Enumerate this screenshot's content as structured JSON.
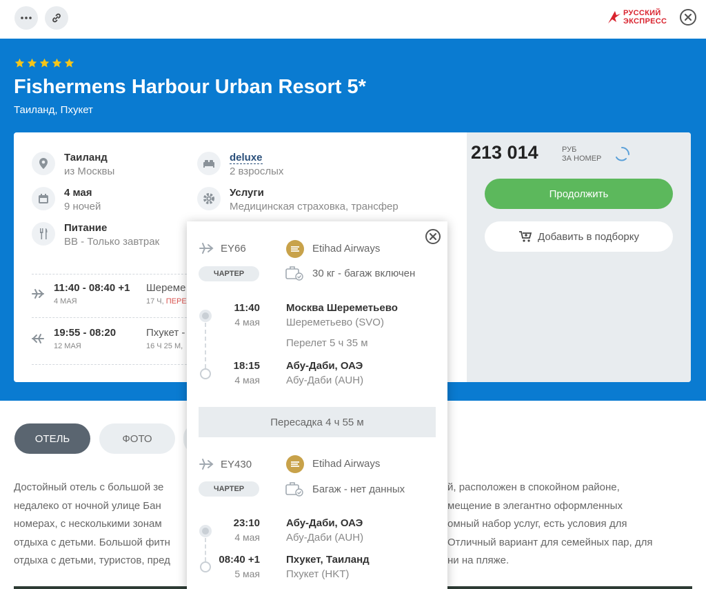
{
  "topbar": {
    "more_icon": "dots-icon",
    "link_icon": "link-icon",
    "logo_text_line1": "РУССКИЙ",
    "logo_text_line2": "ЭКСПРЕСС",
    "close_icon": "close-icon"
  },
  "hotel": {
    "stars": 5,
    "title": "Fishermens Harbour Urban Resort 5*",
    "location": "Таиланд, Пхукет"
  },
  "details": {
    "country": "Таиланд",
    "departure": "из Москвы",
    "room_type": "deluxe",
    "guests": "2 взрослых",
    "date": "4 мая",
    "nights": "9 ночей",
    "services_label": "Услуги",
    "services": "Медицинская страховка, трансфер",
    "meals_label": "Питание",
    "meals": "BB - Только завтрак"
  },
  "flights_summary": [
    {
      "times": "11:40 - 08:40 +1",
      "date": "4 МАЯ",
      "dest": "Шереме",
      "dur": "17 Ч, ",
      "dur_red": "ПЕРЕ"
    },
    {
      "times": "19:55 - 08:20",
      "date": "12 МАЯ",
      "dest": "Пхукет -",
      "dur": "16 Ч 25 М,",
      "dur_red": ""
    }
  ],
  "pricing": {
    "price": "213 014",
    "unit_line1": "РУБ",
    "unit_line2": "ЗА НОМЕР",
    "continue_label": "Продолжить",
    "add_label": "Добавить в подборку"
  },
  "tabs": [
    {
      "label": "ОТЕЛЬ",
      "active": true
    },
    {
      "label": "ФОТО",
      "active": false
    }
  ],
  "description": [
    {
      "left": "Достойный отель с большой зе",
      "right": "й, расположен в спокойном районе,"
    },
    {
      "left": "недалеко от ночной улице Бан",
      "right": "мещение в элегантно оформленных"
    },
    {
      "left": "номерах, с несколькими зонам",
      "right": "омный набор услуг, есть условия для"
    },
    {
      "left": "отдыха с детьми. Большой фитн",
      "right": "Отличный вариант для семейных пар, для"
    },
    {
      "left": "отдыха с детьми, туристов, пред",
      "right": "ни на пляже."
    }
  ],
  "popup": {
    "segments": [
      {
        "flight_no": "EY66",
        "airline": "Etihad Airways",
        "badge": "ЧАРТЕР",
        "baggage": "30 кг - багаж включен",
        "dep_time": "11:40",
        "dep_date": "4 мая",
        "dep_city": "Москва Шереметьево",
        "dep_airport": "Шереметьево (SVO)",
        "duration": "Перелет 5 ч 35 м",
        "arr_time": "18:15",
        "arr_date": "4 мая",
        "arr_city": "Абу-Даби, ОАЭ",
        "arr_airport": "Абу-Даби (AUH)"
      },
      {
        "flight_no": "EY430",
        "airline": "Etihad Airways",
        "badge": "ЧАРТЕР",
        "baggage": "Багаж - нет данных",
        "dep_time": "23:10",
        "dep_date": "4 мая",
        "dep_city": "Абу-Даби, ОАЭ",
        "dep_airport": "Абу-Даби (AUH)",
        "arr_time": "08:40 +1",
        "arr_date": "5 мая",
        "arr_city": "Пхукет, Таиланд",
        "arr_airport": "Пхукет (HKT)"
      }
    ],
    "transfer": "Пересадка 4 ч 55 м"
  },
  "colors": {
    "hero_blue": "#0a7bd1",
    "continue_green": "#5cb85c",
    "star_yellow": "#f5c518",
    "logo_red": "#d9232e"
  }
}
